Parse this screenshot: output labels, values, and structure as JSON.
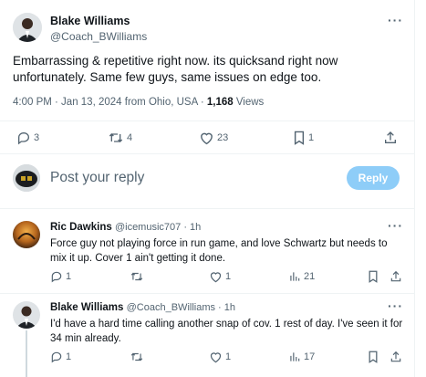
{
  "main_tweet": {
    "author_name": "Blake Williams",
    "author_handle": "@Coach_BWilliams",
    "text_line1": "Embarrassing & repetitive right now. its quicksand right now",
    "text_line2": "unfortunately. Same few guys, same issues on edge too.",
    "timestamp": "4:00 PM · Jan 13, 2024 from Ohio, USA · ",
    "views_count": "1,168",
    "views_label": " Views",
    "replies": "3",
    "retweets": "4",
    "likes": "23",
    "bookmarks": "1"
  },
  "composer": {
    "placeholder": "Post your reply",
    "reply_button": "Reply"
  },
  "replies": [
    {
      "author_name": "Ric Dawkins",
      "author_handle": "@icemusic707 · 1h",
      "text_line1": "Force guy not playing force in run game, and love Schwartz but needs to",
      "text_line2": "mix it up. Cover 1 ain't getting it done.",
      "replies": "1",
      "retweets": "",
      "likes": "1",
      "views": "21"
    },
    {
      "author_name": "Blake Williams",
      "author_handle": "@Coach_BWilliams · 1h",
      "text_line1": "I'd have a hard time calling another snap of cov. 1 rest of day. I've seen it for",
      "text_line2": "34 min already.",
      "replies": "1",
      "retweets": "",
      "likes": "1",
      "views": "17"
    }
  ],
  "more_icon": "···"
}
